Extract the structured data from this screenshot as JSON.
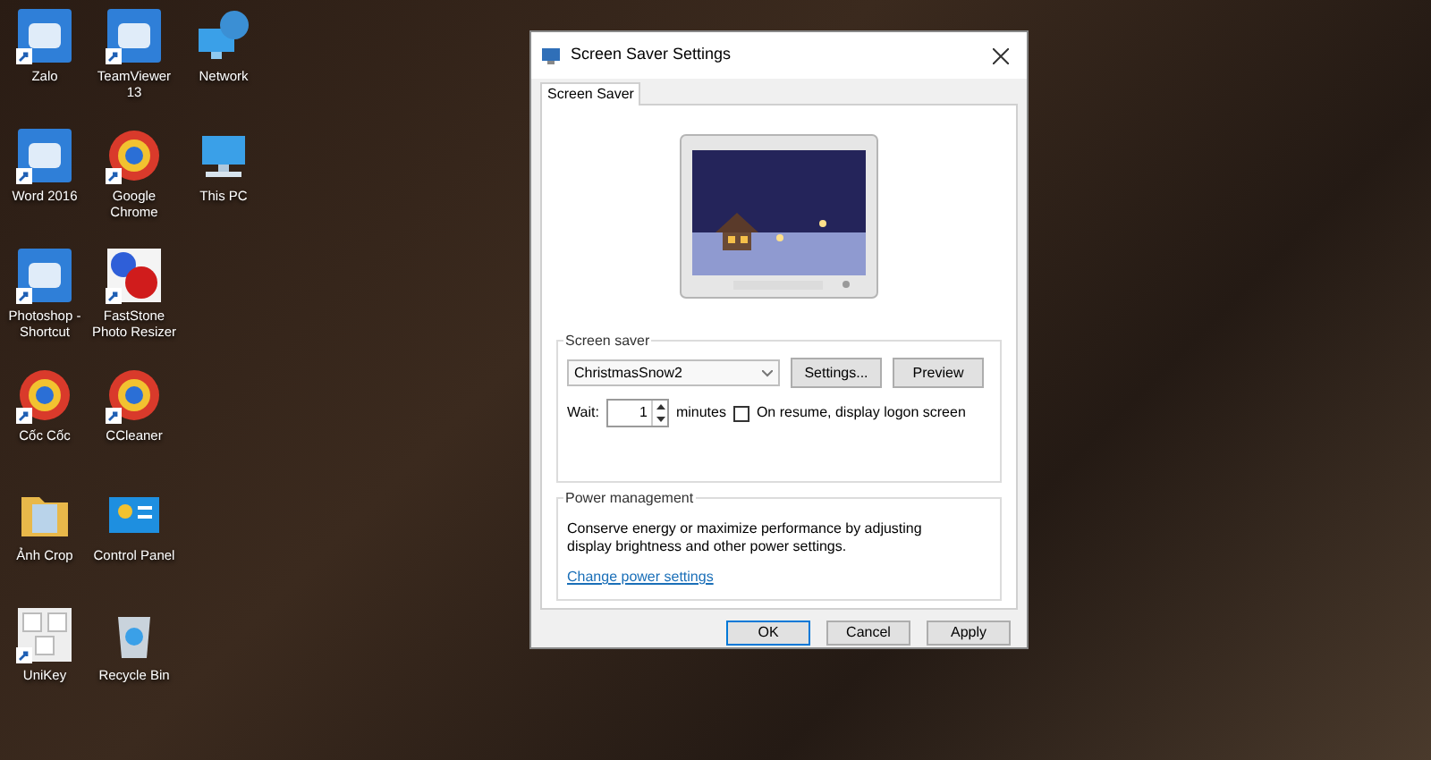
{
  "desktop": {
    "rows": [
      [
        {
          "label": "Zalo",
          "kind": "tile",
          "shortcut": true
        },
        {
          "label": "TeamViewer 13",
          "kind": "tile",
          "shortcut": true
        },
        {
          "label": "Network",
          "kind": "globe",
          "shortcut": false
        }
      ],
      [
        {
          "label": "Word 2016",
          "kind": "tile",
          "shortcut": true
        },
        {
          "label": "Google Chrome",
          "kind": "ring",
          "shortcut": true
        },
        {
          "label": "This PC",
          "kind": "monitor",
          "shortcut": false
        }
      ],
      [
        {
          "label": "Photoshop - Shortcut",
          "kind": "tile",
          "shortcut": true
        },
        {
          "label": "FastStone Photo Resizer",
          "kind": "dots",
          "shortcut": true
        }
      ],
      [
        {
          "label": "Cốc Cốc",
          "kind": "ring",
          "shortcut": true
        },
        {
          "label": "CCleaner",
          "kind": "ring",
          "shortcut": true
        }
      ],
      [
        {
          "label": "Ảnh Crop",
          "kind": "folder",
          "shortcut": false
        },
        {
          "label": "Control Panel",
          "kind": "window",
          "shortcut": false
        }
      ],
      [
        {
          "label": "UniKey",
          "kind": "keys",
          "shortcut": true
        },
        {
          "label": "Recycle Bin",
          "kind": "bin",
          "shortcut": false
        }
      ]
    ]
  },
  "dialog": {
    "title": "Screen Saver Settings",
    "tabs": [
      {
        "label": "Screen Saver",
        "selected": true
      }
    ],
    "screen_saver": {
      "heading": "Screen saver",
      "selection": "ChristmasSnow2",
      "buttons": [
        "Settings...",
        "Preview"
      ],
      "wait_label": "Wait:",
      "wait_value": "1",
      "minutes_label": "minutes",
      "logon_checkbox": {
        "label": "On resume, display logon screen",
        "checked": false
      }
    },
    "power": {
      "heading": "Power management",
      "text": "Conserve energy or maximize performance by adjusting display brightness and other power settings.",
      "link": "Change power settings"
    },
    "buttons": [
      {
        "label": "OK",
        "default": true
      },
      {
        "label": "Cancel",
        "default": false
      },
      {
        "label": "Apply",
        "default": false
      }
    ]
  }
}
